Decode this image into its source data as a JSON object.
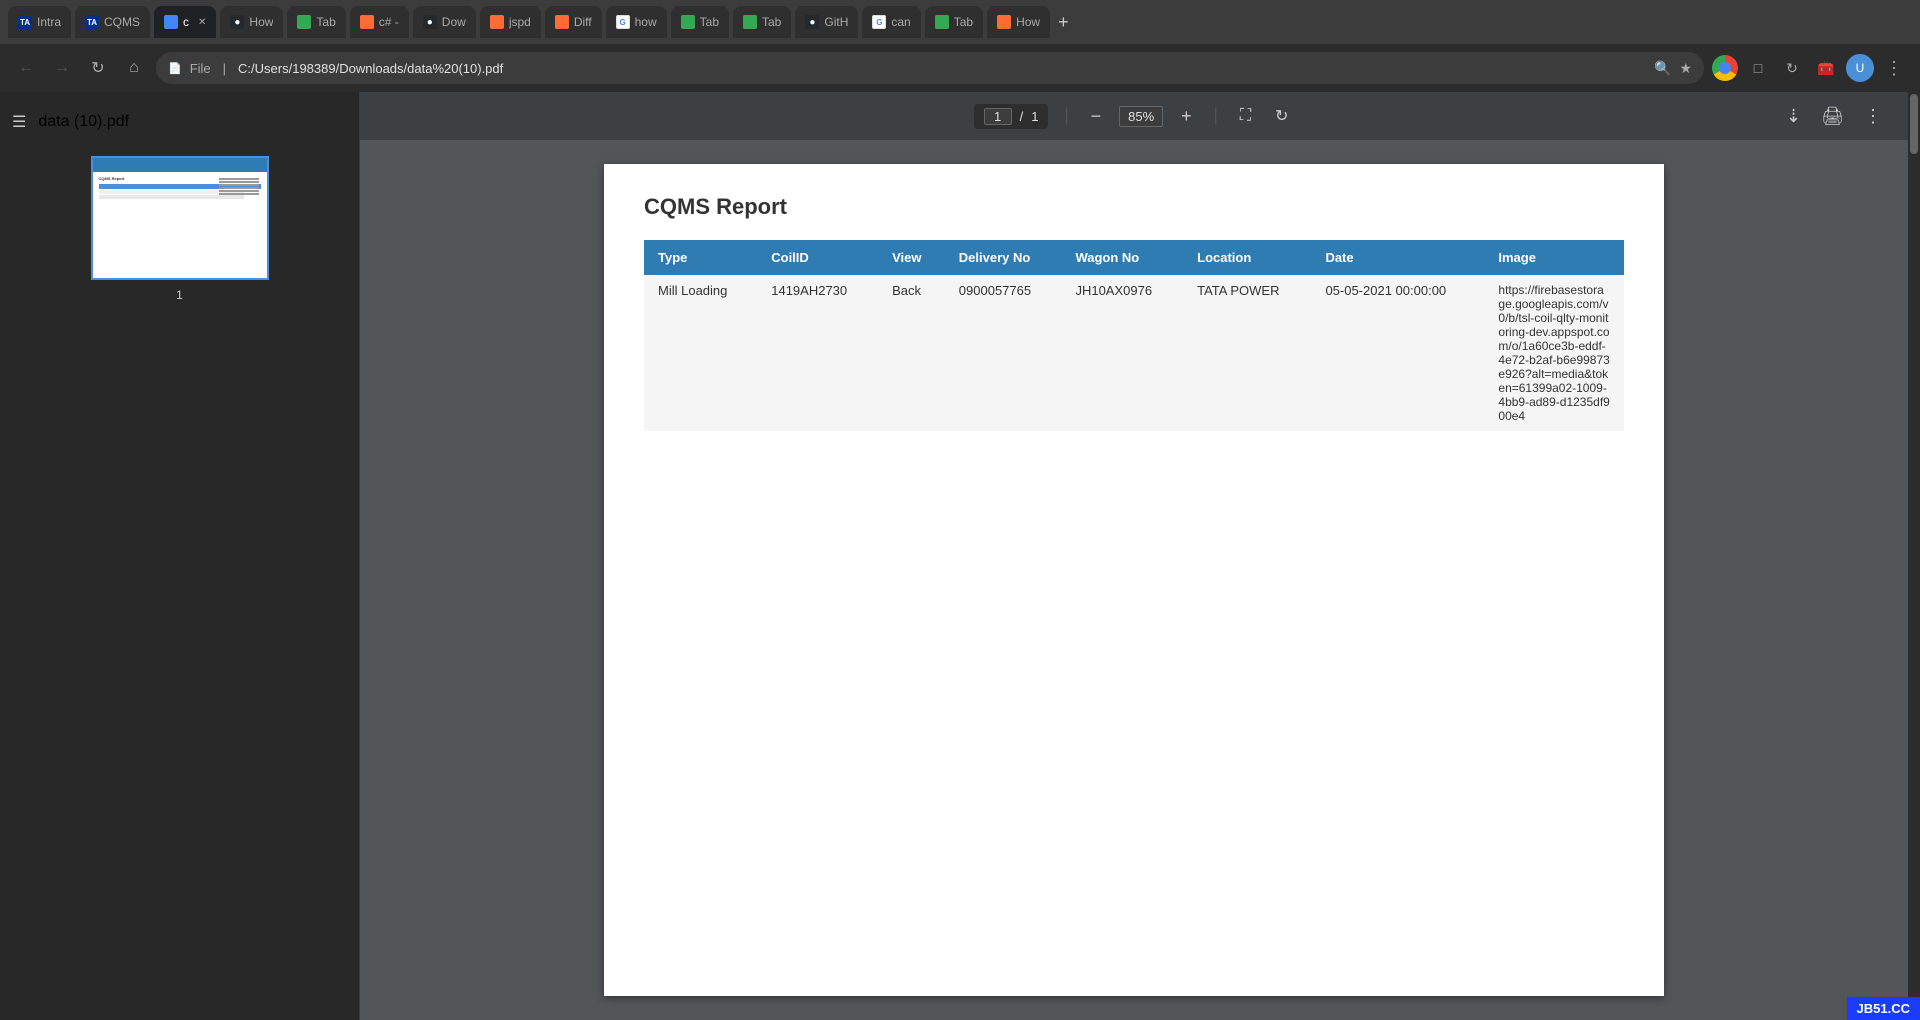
{
  "browser": {
    "tabs": [
      {
        "id": "tab-intra",
        "label": "Intra",
        "favicon_type": "tata",
        "favicon_text": "TA",
        "active": false
      },
      {
        "id": "tab-cqms",
        "label": "CQMS",
        "favicon_type": "tata",
        "favicon_text": "TA",
        "active": false
      },
      {
        "id": "tab-active",
        "label": "c",
        "favicon_type": "blue",
        "active": true,
        "has_close": true
      },
      {
        "id": "tab-how",
        "label": "How",
        "favicon_type": "github",
        "favicon_text": "●",
        "active": false
      },
      {
        "id": "tab-tab1",
        "label": "Tab",
        "favicon_type": "green",
        "active": false
      },
      {
        "id": "tab-sharp",
        "label": "c# -",
        "favicon_type": "orange",
        "active": false
      },
      {
        "id": "tab-dow",
        "label": "Dow",
        "favicon_type": "github",
        "favicon_text": "●",
        "active": false
      },
      {
        "id": "tab-jspd",
        "label": "jspd",
        "favicon_type": "orange",
        "active": false
      },
      {
        "id": "tab-diff",
        "label": "Diff",
        "favicon_type": "orange",
        "active": false
      },
      {
        "id": "tab-ghow",
        "label": "how",
        "favicon_type": "google",
        "favicon_text": "G",
        "active": false
      },
      {
        "id": "tab-tab2",
        "label": "Tab",
        "favicon_type": "green",
        "active": false
      },
      {
        "id": "tab-tab3",
        "label": "Tab",
        "favicon_type": "green",
        "active": false
      },
      {
        "id": "tab-git",
        "label": "GitH",
        "favicon_type": "github",
        "favicon_text": "●",
        "active": false
      },
      {
        "id": "tab-can",
        "label": "can",
        "favicon_type": "google",
        "favicon_text": "G",
        "active": false
      },
      {
        "id": "tab-tab4",
        "label": "Tab",
        "favicon_type": "green",
        "active": false
      },
      {
        "id": "tab-how2",
        "label": "How",
        "favicon_type": "orange",
        "active": false
      }
    ],
    "new_tab_icon": "+",
    "address": "C:/Users/198389/Downloads/data%20(10).pdf",
    "address_prefix": "File",
    "zoom_level": "85%",
    "page_current": "1",
    "page_separator": "/",
    "page_total": "1"
  },
  "pdf": {
    "title": "data (10).pdf",
    "thumbnail_page_label": "1",
    "report_title": "CQMS Report",
    "table": {
      "headers": [
        "Type",
        "CoilID",
        "View",
        "Delivery No",
        "Wagon No",
        "Location",
        "Date",
        "Image"
      ],
      "rows": [
        {
          "type": "Mill Loading",
          "coil_id": "1419AH2730",
          "view": "Back",
          "delivery_no": "0900057765",
          "wagon_no": "JH10AX0976",
          "location": "TATA POWER",
          "date": "05-05-2021 00:00:00",
          "image_url": "https://firebasestorage.googleapis.com/v0/b/tsl-coil-qlty-monitoring-dev.appspot.com/o/1a60ce3b-eddf-4e72-b2af-b6e99873e926?alt=media&token=61399a02-1009-4bb9-ad89-d1235df900e4"
        }
      ]
    }
  },
  "badge": {
    "text": "JB51.CC"
  }
}
